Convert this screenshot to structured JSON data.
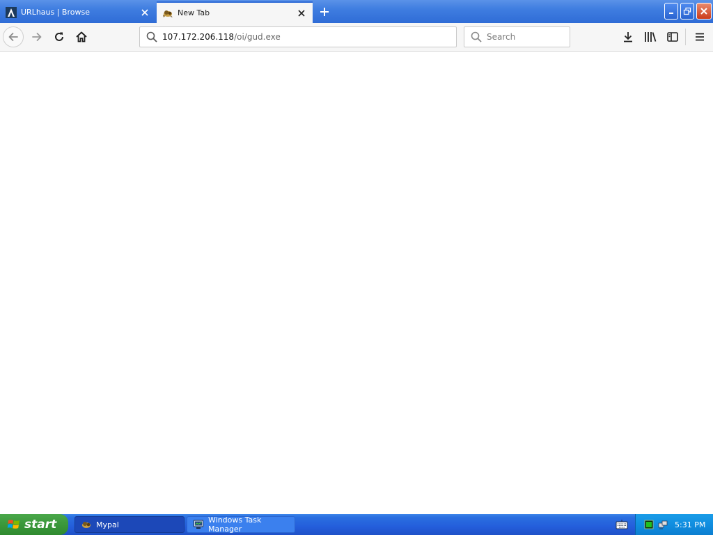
{
  "browser": {
    "tabs": [
      {
        "title": "URLhaus | Browse",
        "active": false,
        "favicon": "urlhaus-icon"
      },
      {
        "title": "New Tab",
        "active": true,
        "favicon": "mypal-icon"
      }
    ],
    "new_tab_icon": "plus-icon",
    "window_controls": [
      "minimize-icon",
      "restore-icon",
      "close-icon"
    ]
  },
  "navbar": {
    "url": {
      "host": "107.172.206.118",
      "path": "/oi/gud.exe"
    },
    "search": {
      "placeholder": "Search",
      "value": ""
    },
    "buttons": [
      "back-icon",
      "forward-icon",
      "reload-icon",
      "home-icon",
      "downloads-icon",
      "library-icon",
      "sidebar-icon",
      "menu-icon"
    ]
  },
  "taskbar": {
    "start_label": "start",
    "tasks": [
      {
        "label": "Mypal",
        "active": true,
        "icon": "mypal-icon"
      },
      {
        "label": "Windows Task Manager",
        "active": false,
        "icon": "task-manager-icon"
      }
    ],
    "clock": "5:31 PM"
  },
  "colors": {
    "tabstrip": "#3f7de0",
    "taskbar": "#245edb",
    "start_button": "#3d9a3d",
    "tray": "#108ee0",
    "close_button": "#cc3c1a"
  }
}
